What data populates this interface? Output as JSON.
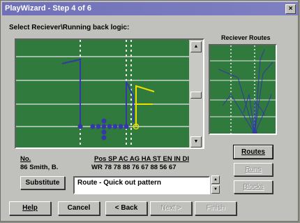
{
  "window": {
    "title": "PlayWizard - Step 4 of 6",
    "close_glyph": "×"
  },
  "prompt": "Select Reciever\\Running back logic:",
  "routes_panel": {
    "label": "Reciever Routes"
  },
  "side_buttons": {
    "routes": "Routes",
    "runs": "Runs",
    "blocks": "Blocks"
  },
  "player": {
    "header_no": "No.",
    "header_stats": "Pos SP AC AG HA ST EN IN DI",
    "name": "86 Smith, B.",
    "stats": "WR 78 78 88 76 67 88 56 67"
  },
  "substitute_label": "Substitute",
  "description": "Route - Quick out pattern",
  "bottom_buttons": {
    "help": "Help",
    "cancel": "Cancel",
    "back": "< Back",
    "next": "Next >",
    "finish": "Finish"
  },
  "colors": {
    "field_green": "#2f7a3c",
    "title_bar": "#6f70b8",
    "route_yellow": "#f0e000",
    "player_blue": "#3438a8"
  }
}
